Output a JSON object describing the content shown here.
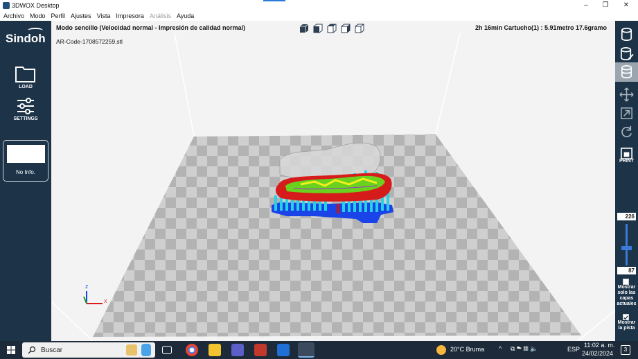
{
  "window": {
    "title": "3DWOX Desktop",
    "buttons": [
      "–",
      "❐",
      "✕"
    ]
  },
  "menu": [
    "Archivo",
    "Modo",
    "Perfil",
    "Ajustes",
    "Vista",
    "Impresora",
    "Análisis",
    "Ayuda"
  ],
  "left_panel": {
    "logo": "Sindoh",
    "load_label": "LOAD",
    "settings_label": "SETTINGS",
    "info_label": "No Info."
  },
  "viewport": {
    "mode_label": "Modo sencillo (Velocidad normal - Impresión de calidad normal)",
    "file_name": "AR-Code-1708572259.stl",
    "print_info": "2h 16min  Cartucho(1) : 5.91metro 17.6gramo",
    "axis_x": "X",
    "axis_z": "Z"
  },
  "right_panel": {
    "print_label": "PRINT",
    "layer_top": "226",
    "layer_bottom": "87",
    "show_layers_label": "Mostrar solo las capas actuales",
    "show_track_label": "Mostrar la pista"
  },
  "taskbar": {
    "search_placeholder": "Buscar",
    "weather": "20°C  Bruma",
    "language": "ESP",
    "time": "11:02 a. m.",
    "date": "24/02/2024",
    "notifications": "3"
  },
  "colors": {
    "panel": "#1c3348",
    "accent": "#3a7bd5",
    "support": "#22d3e6",
    "base": "#1a44e8",
    "model": "#d61b1b"
  }
}
